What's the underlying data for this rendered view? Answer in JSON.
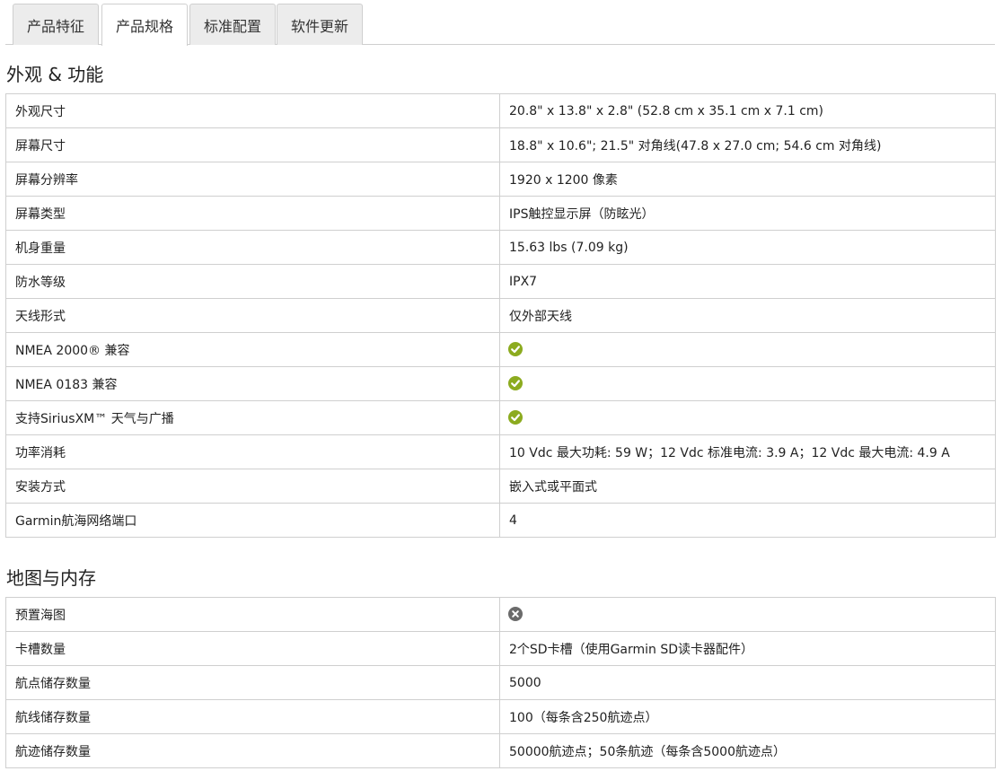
{
  "tabs": [
    {
      "label": "产品特征",
      "active": false
    },
    {
      "label": "产品规格",
      "active": true
    },
    {
      "label": "标准配置",
      "active": false
    },
    {
      "label": "软件更新",
      "active": false
    }
  ],
  "sections": [
    {
      "title": "外观 & 功能",
      "rows": [
        {
          "label": "外观尺寸",
          "value": "20.8\" x 13.8\" x 2.8\" (52.8 cm x 35.1 cm x 7.1 cm)"
        },
        {
          "label": "屏幕尺寸",
          "value": "18.8\" x 10.6\"; 21.5\" 对角线(47.8 x 27.0 cm; 54.6 cm 对角线)"
        },
        {
          "label": "屏幕分辨率",
          "value": "1920 x 1200 像素"
        },
        {
          "label": "屏幕类型",
          "value": "IPS触控显示屏（防眩光）"
        },
        {
          "label": "机身重量",
          "value": "15.63 lbs (7.09 kg)"
        },
        {
          "label": "防水等级",
          "value": "IPX7"
        },
        {
          "label": "天线形式",
          "value": "仅外部天线"
        },
        {
          "label": "NMEA 2000® 兼容",
          "icon": "check-circle-icon"
        },
        {
          "label": "NMEA 0183 兼容",
          "icon": "check-circle-icon"
        },
        {
          "label": "支持SiriusXM™ 天气与广播",
          "icon": "check-circle-icon"
        },
        {
          "label": "功率消耗",
          "value": "10 Vdc 最大功耗: 59 W；12 Vdc 标准电流: 3.9 A；12 Vdc 最大电流: 4.9 A"
        },
        {
          "label": "安装方式",
          "value": "嵌入式或平面式"
        },
        {
          "label": "Garmin航海网络端口",
          "value": "4"
        }
      ]
    },
    {
      "title": "地图与内存",
      "rows": [
        {
          "label": "预置海图",
          "icon": "x-circle-icon"
        },
        {
          "label": "卡槽数量",
          "value": "2个SD卡槽（使用Garmin SD读卡器配件）"
        },
        {
          "label": "航点储存数量",
          "value": "5000"
        },
        {
          "label": "航线储存数量",
          "value": "100（每条含250航迹点）"
        },
        {
          "label": "航迹储存数量",
          "value": "50000航迹点；50条航迹（每条含5000航迹点）"
        }
      ]
    }
  ],
  "colors": {
    "check": "#8cab1f",
    "x": "#6b6b6b",
    "border": "#cfcfcf",
    "tab_inactive": "#ececec"
  }
}
